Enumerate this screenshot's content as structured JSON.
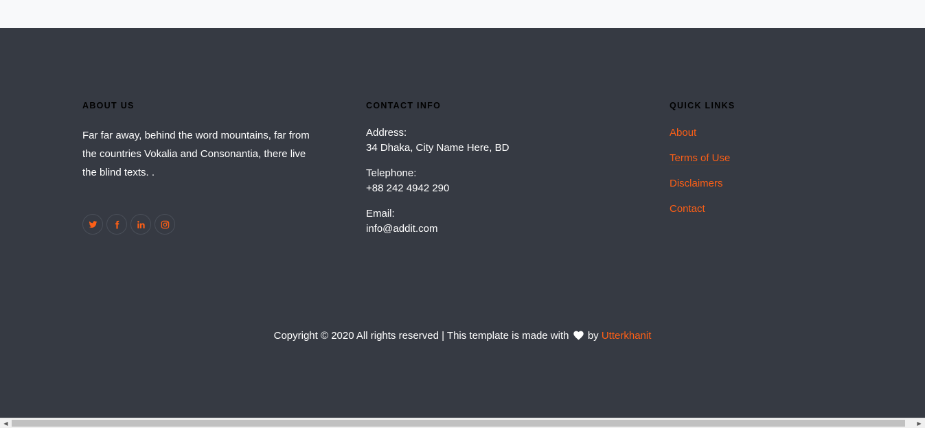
{
  "about": {
    "heading": "About Us",
    "text": "Far far away, behind the word mountains, far from the countries Vokalia and Consonantia, there live the blind texts. .",
    "social": [
      {
        "icon": "twitter-icon"
      },
      {
        "icon": "facebook-icon"
      },
      {
        "icon": "linkedin-icon"
      },
      {
        "icon": "instagram-icon"
      }
    ]
  },
  "contact": {
    "heading": "Contact Info",
    "address_label": "Address:",
    "address_value": "34 Dhaka, City Name Here, BD",
    "telephone_label": "Telephone:",
    "telephone_value": "+88 242 4942 290",
    "email_label": "Email:",
    "email_value": "info@addit.com"
  },
  "quick_links": {
    "heading": "Quick Links",
    "items": [
      "About",
      "Terms of Use",
      "Disclaimers",
      "Contact"
    ]
  },
  "copyright": {
    "prefix": "Copyright © 2020 All rights reserved | This template is made with",
    "by": "by",
    "author": "Utterkhanit"
  },
  "colors": {
    "footer_bg": "#363a43",
    "accent": "#fd5f16",
    "page_bg": "#f8f9fa"
  }
}
